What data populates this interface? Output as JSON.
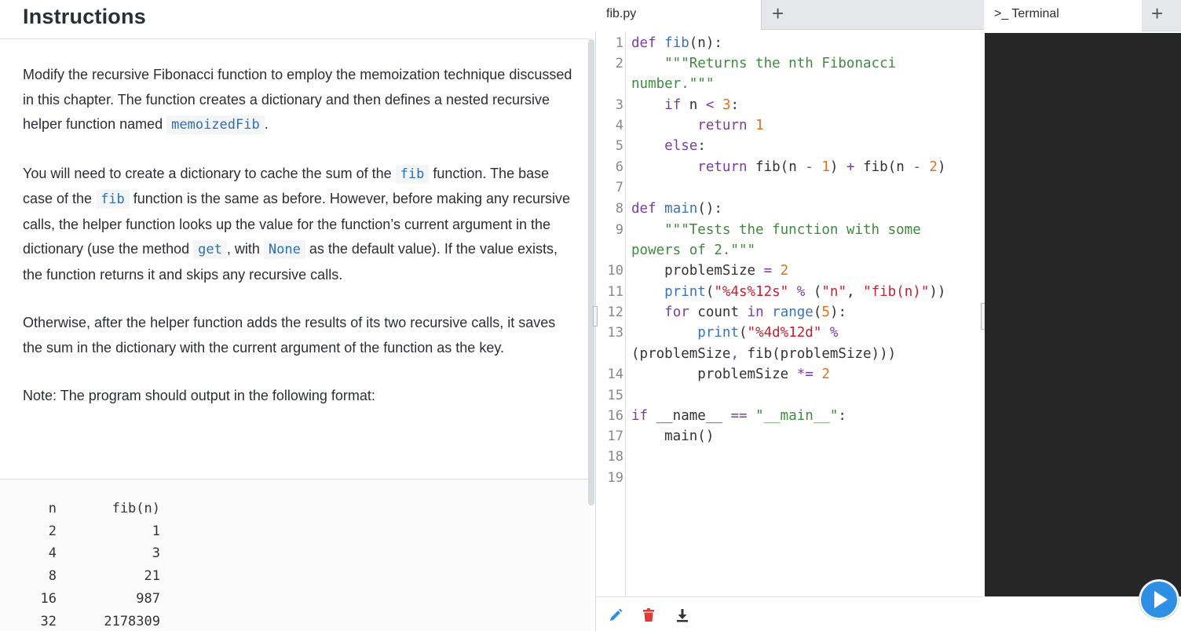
{
  "instructions": {
    "title": "Instructions",
    "p1": {
      "text_a": "Modify the recursive Fibonacci function to employ the memoization technique discussed in this chapter. The function creates a dictionary and then defines a nested recursive helper function named ",
      "code_a": "memoizedFib",
      "text_b": "."
    },
    "p2": {
      "text_a": "You will need to create a dictionary to cache the sum of the ",
      "code_a": "fib",
      "text_b": " function. The base case of the ",
      "code_b": "fib",
      "text_c": " function is the same as before. However, before making any recursive calls, the helper function looks up the value for the function’s current argument in the dictionary (use the method ",
      "code_c": "get",
      "text_d": ", with ",
      "code_d": "None",
      "text_e": " as the default value). If the value exists, the function returns it and skips any recursive calls."
    },
    "p3": "Otherwise, after the helper function adds the results of its two recursive calls, it saves the sum in the dictionary with the current argument of the function as the key.",
    "p4": "Note: The program should output in the following format:",
    "output": {
      "header": {
        "n": "n",
        "f": "fib(n)"
      },
      "rows": [
        {
          "n": "2",
          "f": "1"
        },
        {
          "n": "4",
          "f": "3"
        },
        {
          "n": "8",
          "f": "21"
        },
        {
          "n": "16",
          "f": "987"
        },
        {
          "n": "32",
          "f": "2178309"
        }
      ]
    }
  },
  "editor": {
    "tab_label": "fib.py",
    "add_tab": "+",
    "line_numbers": [
      "1",
      "2",
      "3",
      "4",
      "5",
      "6",
      "7",
      "8",
      "9",
      "10",
      "11",
      "12",
      "13",
      "14",
      "15",
      "16",
      "17",
      "18",
      "19"
    ],
    "code": {
      "l1": [
        "def ",
        "fib",
        "(n):"
      ],
      "l2a": "    \"\"\"Returns the nth Fibonacci",
      "l2b": "number.\"\"\"",
      "l3": [
        "    ",
        "if",
        " n ",
        "<",
        " ",
        "3",
        ":"
      ],
      "l4": [
        "        ",
        "return",
        " ",
        "1"
      ],
      "l5": [
        "    ",
        "else",
        ":"
      ],
      "l6": [
        "        ",
        "return",
        " fib(n ",
        "-",
        " ",
        "1",
        ") ",
        "+",
        " fib(n ",
        "-",
        " ",
        "2",
        ")"
      ],
      "l8": [
        "def ",
        "main",
        "():"
      ],
      "l9a": "    \"\"\"Tests the function with some",
      "l9b": "powers of 2.\"\"\"",
      "l10": [
        "    problemSize ",
        "=",
        " ",
        "2"
      ],
      "l11": [
        "    ",
        "print",
        "(",
        "\"%4s%12s\"",
        " ",
        "%",
        " (",
        "\"n\"",
        ", ",
        "\"fib(n)\"",
        "))"
      ],
      "l12": [
        "    ",
        "for",
        " count ",
        "in",
        " ",
        "range",
        "(",
        "5",
        "):"
      ],
      "l13a": [
        "        ",
        "print",
        "(",
        "\"%4d%12d\"",
        " ",
        "%"
      ],
      "l13b": [
        "(problemSize",
        ",",
        " fib(problemSize)))"
      ],
      "l14": [
        "        problemSize ",
        "*=",
        " ",
        "2"
      ],
      "l16": [
        "if",
        " __name__ ",
        "==",
        " ",
        "\"__main__\"",
        ":"
      ],
      "l17": [
        "    main()"
      ]
    }
  },
  "terminal": {
    "tab_label": ">_ Terminal",
    "add_tab": "+"
  },
  "icons": {
    "edit": "pencil-icon",
    "delete": "trash-icon",
    "download": "download-icon",
    "run": "play-icon"
  },
  "colors": {
    "keyword": "#7a3da6",
    "function": "#3b73b9",
    "number": "#e07020",
    "string": "#3f8a3f",
    "run_button": "#2f8fe4",
    "terminal_bg": "#262626"
  }
}
